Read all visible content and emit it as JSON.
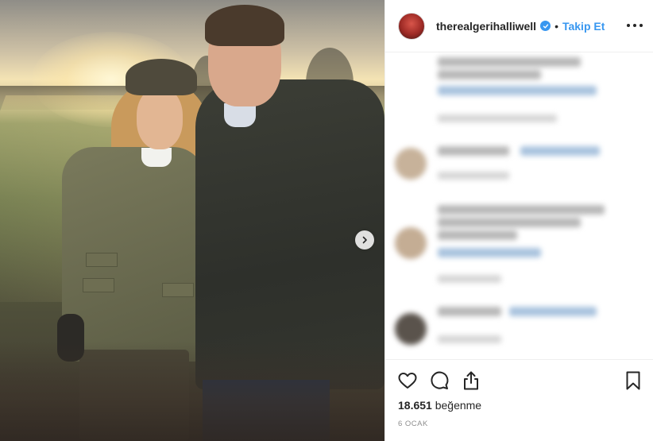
{
  "post": {
    "username": "therealgerihalliwell",
    "separator": "•",
    "follow_label": "Takip Et",
    "likes_count": "18.651",
    "likes_suffix": "beğenme",
    "date": "6 OCAK"
  },
  "icons": {
    "verified": "verified-badge-icon",
    "more": "more-options-icon",
    "next": "chevron-right-icon",
    "like": "heart-icon",
    "comment": "comment-bubble-icon",
    "share": "share-icon",
    "save": "bookmark-icon"
  },
  "colors": {
    "accent": "#3897f0",
    "text": "#262626",
    "muted": "#8e8e8e",
    "border": "#efefef"
  }
}
